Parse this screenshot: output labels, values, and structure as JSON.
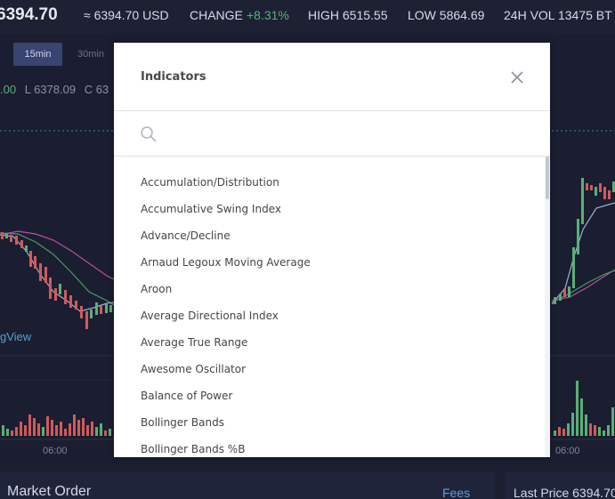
{
  "ticker": {
    "price": "6394.70",
    "usd": "≈ 6394.70 USD",
    "change_label": "CHANGE",
    "change_value": "+8.31%",
    "high": "HIGH 6515.55",
    "low": "LOW 5864.69",
    "vol": "24H VOL 13475 BT"
  },
  "chart": {
    "timeframes": [
      "15min",
      "30min"
    ],
    "ohlc_partial": ".00",
    "ohlc_low": "L 6378.09",
    "ohlc_close": "C 63",
    "watermark": "gView",
    "time_labels": [
      "06:00",
      "06:00"
    ]
  },
  "bottom": {
    "market_order": "Market Order",
    "fees": "Fees",
    "last_price": "Last Price 6394.70"
  },
  "modal": {
    "title": "Indicators",
    "search_placeholder": "",
    "items": [
      "Accumulation/Distribution",
      "Accumulative Swing Index",
      "Advance/Decline",
      "Arnaud Legoux Moving Average",
      "Aroon",
      "Average Directional Index",
      "Average True Range",
      "Awesome Oscillator",
      "Balance of Power",
      "Bollinger Bands",
      "Bollinger Bands %B"
    ]
  },
  "colors": {
    "up": "#58b078",
    "down": "#d25a5a",
    "accent": "#5a9fd6"
  }
}
